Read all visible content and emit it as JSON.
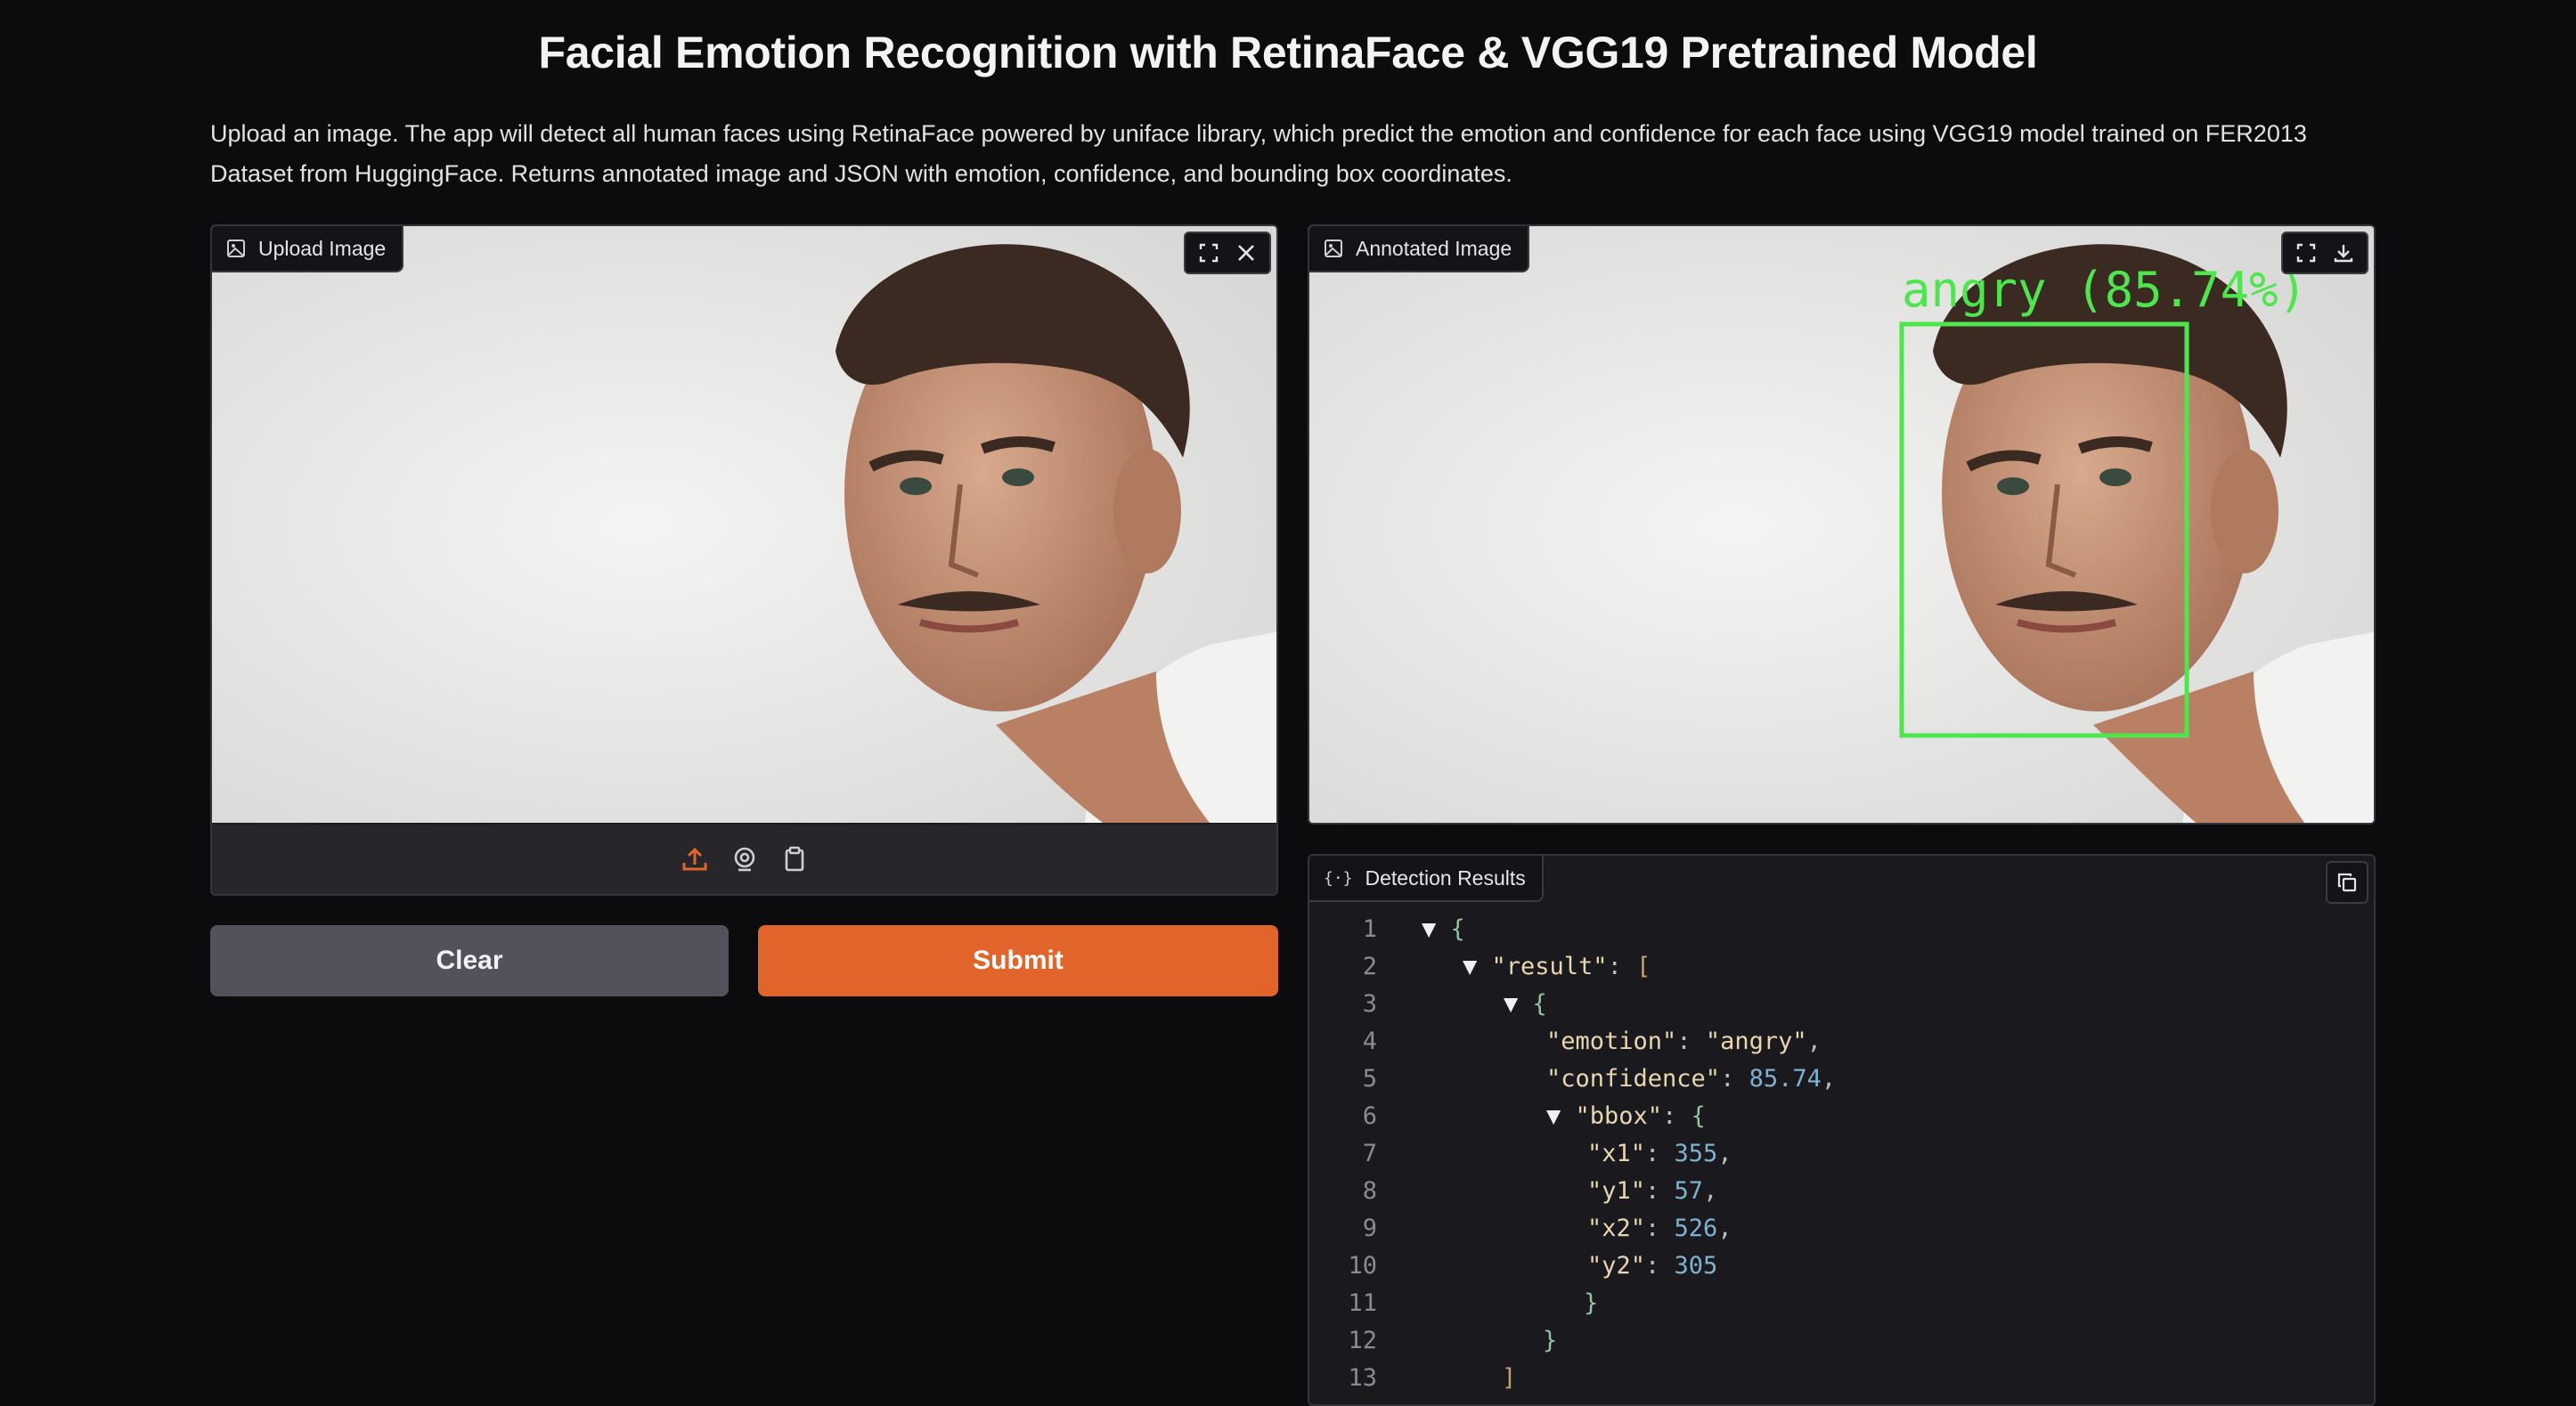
{
  "header": {
    "title": "Facial Emotion Recognition with RetinaFace & VGG19 Pretrained Model",
    "description": "Upload an image. The app will detect all human faces using RetinaFace powered by uniface library, which predict the emotion and confidence for each face using VGG19 model trained on FER2013 Dataset from HuggingFace. Returns annotated image and JSON with emotion, confidence, and bounding box coordinates."
  },
  "upload_panel": {
    "label": "Upload Image",
    "icons": {
      "label": "image-icon",
      "fullscreen": "fullscreen-icon",
      "close": "close-icon",
      "upload": "upload-icon",
      "webcam": "webcam-icon",
      "clipboard": "clipboard-icon"
    }
  },
  "annotated_panel": {
    "label": "Annotated Image",
    "overlay_text": "angry (85.74%)",
    "box_color": "#4de64d",
    "icons": {
      "label": "image-icon",
      "fullscreen": "fullscreen-icon",
      "download": "download-icon"
    }
  },
  "buttons": {
    "clear": "Clear",
    "submit": "Submit"
  },
  "colors": {
    "submit": "#e1652b",
    "clear": "#51525c",
    "background": "#0c0c0f"
  },
  "results_panel": {
    "label": "Detection Results",
    "icons": {
      "label": "json-braces-icon",
      "copy": "copy-icon"
    },
    "lines": [
      {
        "n": "1",
        "tri": "▼ ",
        "parts": [
          {
            "t": "{",
            "c": "br"
          }
        ]
      },
      {
        "n": "2",
        "tri": "▼ ",
        "parts": [
          {
            "t": "\"result\"",
            "c": "k"
          },
          {
            "t": ": ",
            "c": "p"
          },
          {
            "t": "[",
            "c": "bb"
          }
        ]
      },
      {
        "n": "3",
        "tri": "▼ ",
        "parts": [
          {
            "t": "{",
            "c": "br"
          }
        ]
      },
      {
        "n": "4",
        "tri": "",
        "parts": [
          {
            "t": "\"emotion\"",
            "c": "k"
          },
          {
            "t": ": ",
            "c": "p"
          },
          {
            "t": "\"angry\"",
            "c": "s"
          },
          {
            "t": ",",
            "c": "p"
          }
        ]
      },
      {
        "n": "5",
        "tri": "",
        "parts": [
          {
            "t": "\"confidence\"",
            "c": "k"
          },
          {
            "t": ": ",
            "c": "p"
          },
          {
            "t": "85.74",
            "c": "n"
          },
          {
            "t": ",",
            "c": "p"
          }
        ]
      },
      {
        "n": "6",
        "tri": "▼ ",
        "parts": [
          {
            "t": "\"bbox\"",
            "c": "k"
          },
          {
            "t": ": ",
            "c": "p"
          },
          {
            "t": "{",
            "c": "br"
          }
        ]
      },
      {
        "n": "7",
        "tri": "",
        "parts": [
          {
            "t": "\"x1\"",
            "c": "k"
          },
          {
            "t": ": ",
            "c": "p"
          },
          {
            "t": "355",
            "c": "n"
          },
          {
            "t": ",",
            "c": "p"
          }
        ]
      },
      {
        "n": "8",
        "tri": "",
        "parts": [
          {
            "t": "\"y1\"",
            "c": "k"
          },
          {
            "t": ": ",
            "c": "p"
          },
          {
            "t": "57",
            "c": "n"
          },
          {
            "t": ",",
            "c": "p"
          }
        ]
      },
      {
        "n": "9",
        "tri": "",
        "parts": [
          {
            "t": "\"x2\"",
            "c": "k"
          },
          {
            "t": ": ",
            "c": "p"
          },
          {
            "t": "526",
            "c": "n"
          },
          {
            "t": ",",
            "c": "p"
          }
        ]
      },
      {
        "n": "10",
        "tri": "",
        "parts": [
          {
            "t": "\"y2\"",
            "c": "k"
          },
          {
            "t": ": ",
            "c": "p"
          },
          {
            "t": "305",
            "c": "n"
          }
        ]
      },
      {
        "n": "11",
        "tri": "",
        "parts": [
          {
            "t": "}",
            "c": "br"
          }
        ]
      },
      {
        "n": "12",
        "tri": "",
        "parts": [
          {
            "t": "}",
            "c": "br"
          }
        ]
      },
      {
        "n": "13",
        "tri": "",
        "parts": [
          {
            "t": "]",
            "c": "bb"
          }
        ]
      }
    ]
  }
}
